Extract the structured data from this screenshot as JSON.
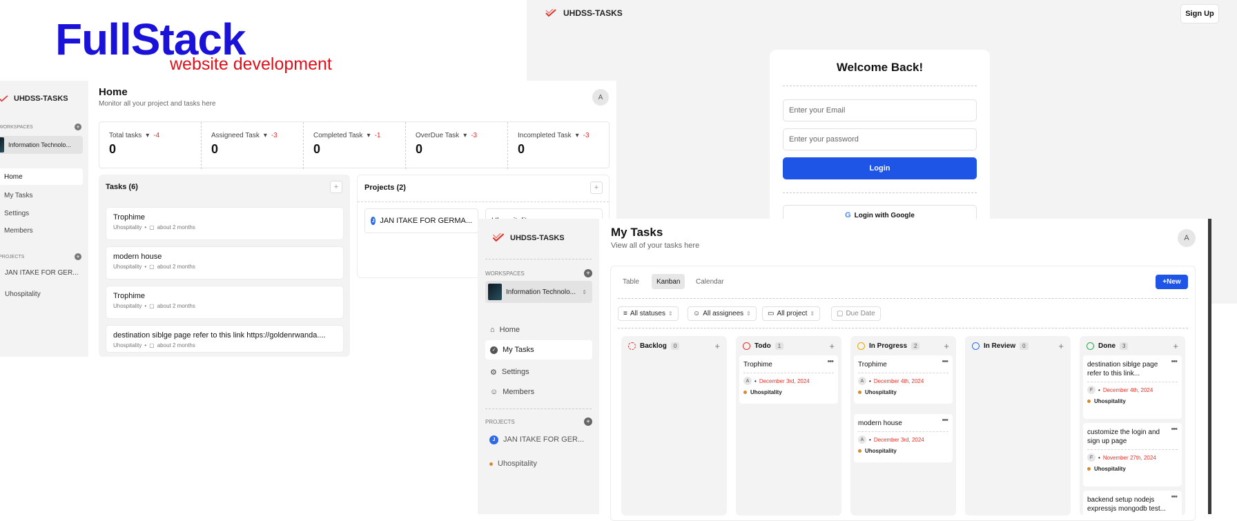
{
  "banner": {
    "title": "FullStack",
    "subtitle": "website development"
  },
  "brand": "UHDSS-TASKS",
  "login": {
    "signup": "Sign Up",
    "heading": "Welcome Back!",
    "email_placeholder": "Enter your Email",
    "password_placeholder": "Enter your password",
    "login_button": "Login",
    "google_button": "Login with Google"
  },
  "sidebar": {
    "workspaces_label": "WORKSPACES",
    "workspace_name": "Information Technolo...",
    "nav": [
      {
        "label": "Home",
        "icon": "home-icon"
      },
      {
        "label": "My Tasks",
        "icon": "check-circle-icon"
      },
      {
        "label": "Settings",
        "icon": "gear-icon"
      },
      {
        "label": "Members",
        "icon": "user-icon"
      }
    ],
    "projects_label": "PROJECTS",
    "projects": [
      {
        "name": "JAN ITAKE FOR GER...",
        "badge": "J"
      },
      {
        "name": "Uhospitality"
      }
    ]
  },
  "home": {
    "title": "Home",
    "subtitle": "Monitor all your project and tasks here",
    "avatar": "A",
    "stats": [
      {
        "title": "Total tasks",
        "delta": "-4",
        "value": "0"
      },
      {
        "title": "Assigneed Task",
        "delta": "-3",
        "value": "0"
      },
      {
        "title": "Completed Task",
        "delta": "-1",
        "value": "0"
      },
      {
        "title": "OverDue Task",
        "delta": "-3",
        "value": "0"
      },
      {
        "title": "Incompleted Task",
        "delta": "-3",
        "value": "0"
      }
    ],
    "tasks_title": "Tasks (6)",
    "tasks": [
      {
        "name": "Trophime",
        "project": "Uhospitality",
        "time": "about 2 months"
      },
      {
        "name": "modern house",
        "project": "Uhospitality",
        "time": "about 2 months"
      },
      {
        "name": "Trophime",
        "project": "Uhospitality",
        "time": "about 2 months"
      },
      {
        "name": "destination siblge page refer to this link https://goldenrwanda....",
        "project": "Uhospitality",
        "time": "about 2 months"
      }
    ],
    "projects_title": "Projects (2)",
    "project_cards": [
      {
        "name": "JAN ITAKE FOR GERMA...",
        "badge": "J"
      },
      {
        "name": "Uhospitality"
      }
    ],
    "sidebar_workspace": "Information Technolo...",
    "sidebar_project": "JAN ITAKE FOR GER..."
  },
  "mytasks": {
    "title": "My Tasks",
    "subtitle": "View all of your tasks here",
    "avatar": "A",
    "tabs": [
      "Table",
      "Kanban",
      "Calendar"
    ],
    "new_button": "New",
    "filters": [
      "All statuses",
      "All assignees",
      "All project",
      "Due Date"
    ],
    "columns": [
      {
        "name": "Backlog",
        "count": "0",
        "color": "#e0342a",
        "cards": []
      },
      {
        "name": "Todo",
        "count": "1",
        "color": "#e0342a",
        "cards": [
          {
            "title": "Trophime",
            "avatar": "A",
            "date": "December 3rd, 2024",
            "project": "Uhospitality"
          }
        ]
      },
      {
        "name": "In Progress",
        "count": "2",
        "color": "#e8a800",
        "cards": [
          {
            "title": "Trophime",
            "avatar": "A",
            "date": "December 4th, 2024",
            "project": "Uhospitality"
          },
          {
            "title": "modern house",
            "avatar": "A",
            "date": "December 3rd, 2024",
            "project": "Uhospitality"
          }
        ]
      },
      {
        "name": "In Review",
        "count": "0",
        "color": "#2d6be6",
        "cards": []
      },
      {
        "name": "Done",
        "count": "3",
        "color": "#2aa84a",
        "cards": [
          {
            "title": "destination siblge page refer to this link...",
            "avatar": "F",
            "date": "December 4th, 2024",
            "project": "Uhospitality"
          },
          {
            "title": "customize the login and sign up page",
            "avatar": "F",
            "date": "November 27th, 2024",
            "project": "Uhospitality"
          },
          {
            "title": "backend setup nodejs expressjs mongodb test...",
            "avatar": "",
            "date": "",
            "project": ""
          }
        ]
      }
    ]
  }
}
